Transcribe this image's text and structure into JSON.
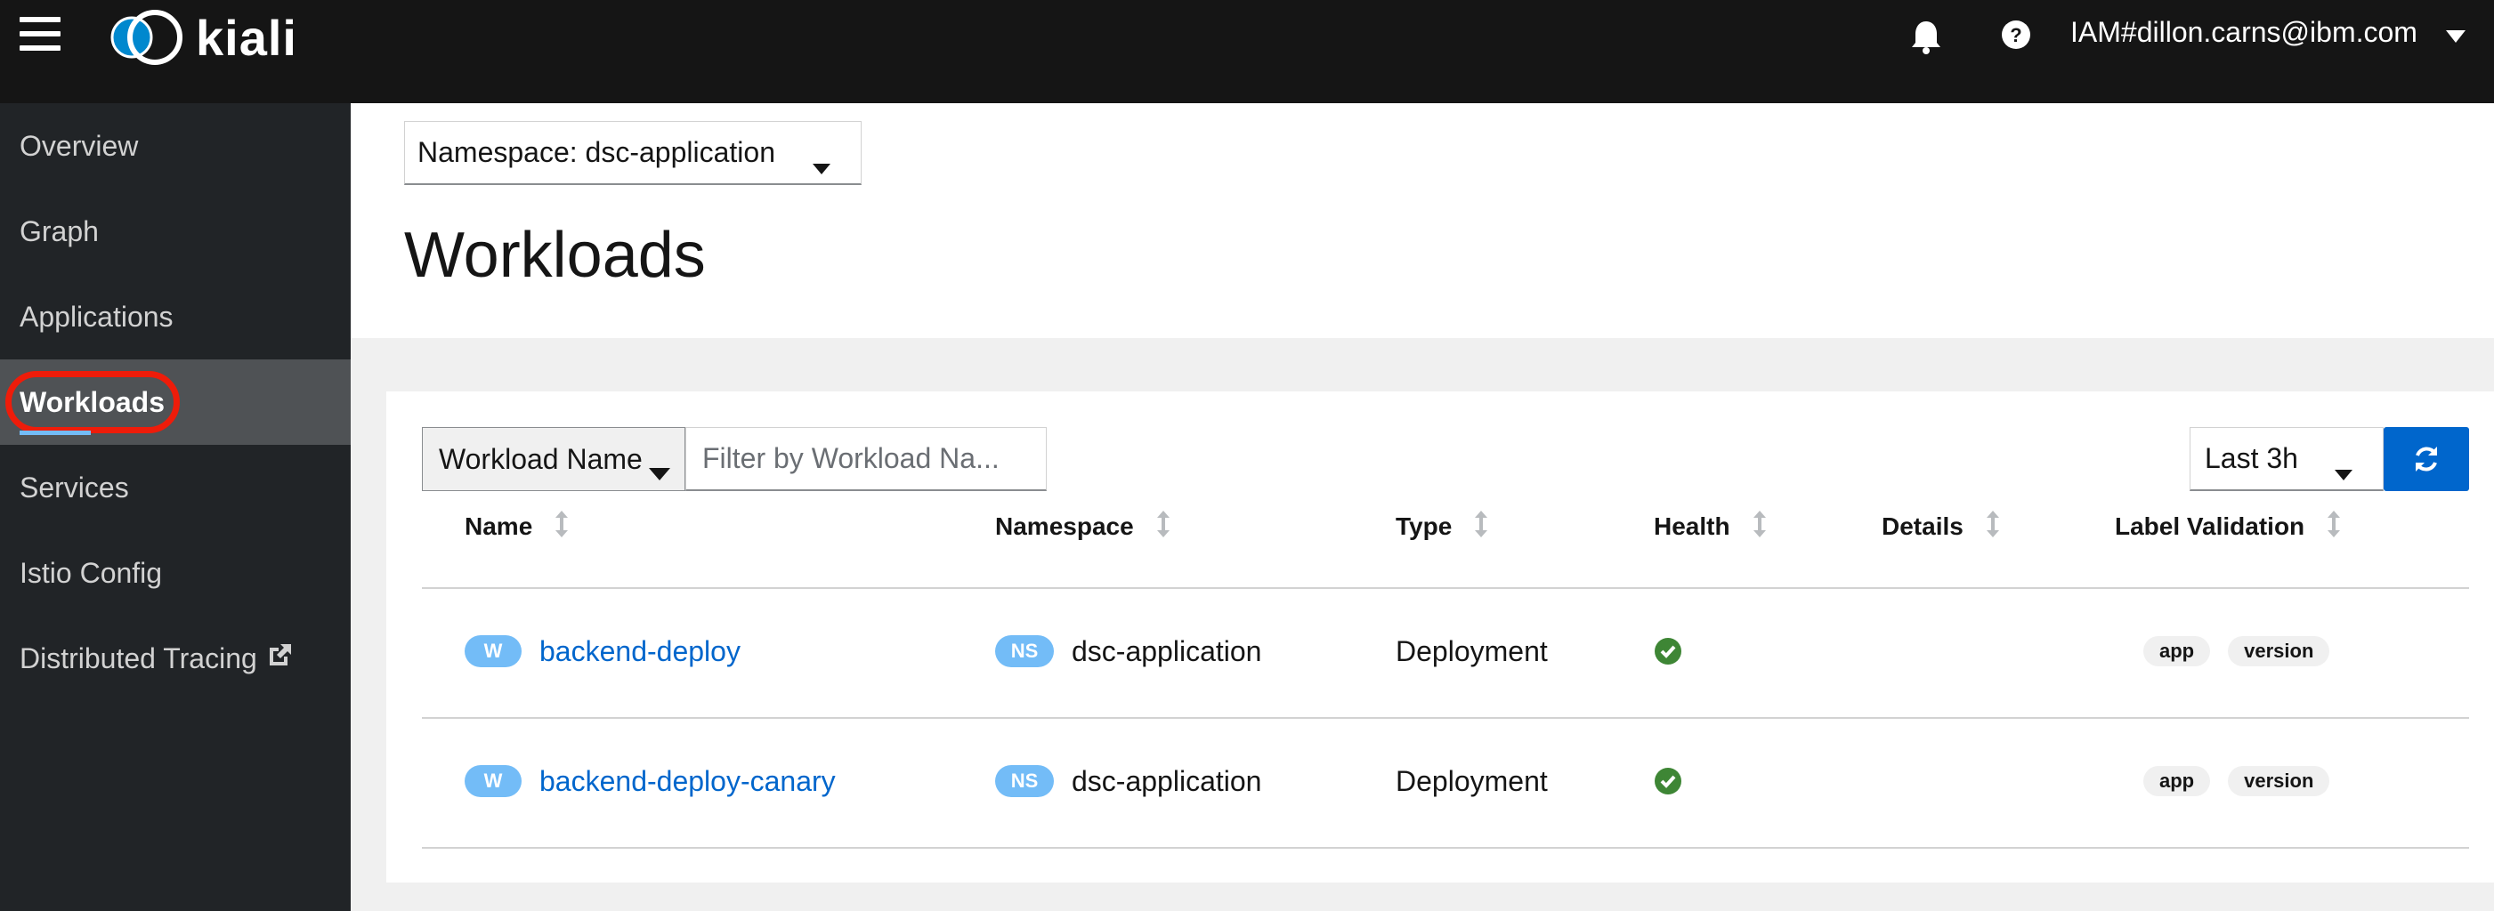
{
  "masthead": {
    "logo_text": "kiali",
    "user": "IAM#dillon.carns@ibm.com",
    "icons": [
      "hamburger-menu-icon",
      "bell-icon",
      "help-icon",
      "caret-down-icon"
    ]
  },
  "sidebar": {
    "items": [
      {
        "label": "Overview",
        "active": false
      },
      {
        "label": "Graph",
        "active": false
      },
      {
        "label": "Applications",
        "active": false
      },
      {
        "label": "Workloads",
        "active": true
      },
      {
        "label": "Services",
        "active": false
      },
      {
        "label": "Istio Config",
        "active": false
      },
      {
        "label": "Distributed Tracing",
        "active": false,
        "external": true
      }
    ]
  },
  "header": {
    "namespace_select": "Namespace: dsc-application",
    "title": "Workloads"
  },
  "toolbar": {
    "filter_type": "Workload Name",
    "filter_placeholder": "Filter by Workload Na...",
    "time_range": "Last 3h"
  },
  "table": {
    "columns": [
      "Name",
      "Namespace",
      "Type",
      "Health",
      "Details",
      "Label Validation"
    ],
    "rows": [
      {
        "badge": "W",
        "name": "backend-deploy",
        "ns_badge": "NS",
        "namespace": "dsc-application",
        "type": "Deployment",
        "health": "healthy",
        "labels": [
          "app",
          "version"
        ]
      },
      {
        "badge": "W",
        "name": "backend-deploy-canary",
        "ns_badge": "NS",
        "namespace": "dsc-application",
        "type": "Deployment",
        "health": "healthy",
        "labels": [
          "app",
          "version"
        ]
      }
    ]
  },
  "colors": {
    "masthead": "#151515",
    "sidebar": "#212427",
    "sidebar_active": "#4f5255",
    "highlight_outline": "#ee1c0a",
    "link": "#0066cc",
    "badge": "#73bcf7",
    "healthy": "#3e8635"
  }
}
